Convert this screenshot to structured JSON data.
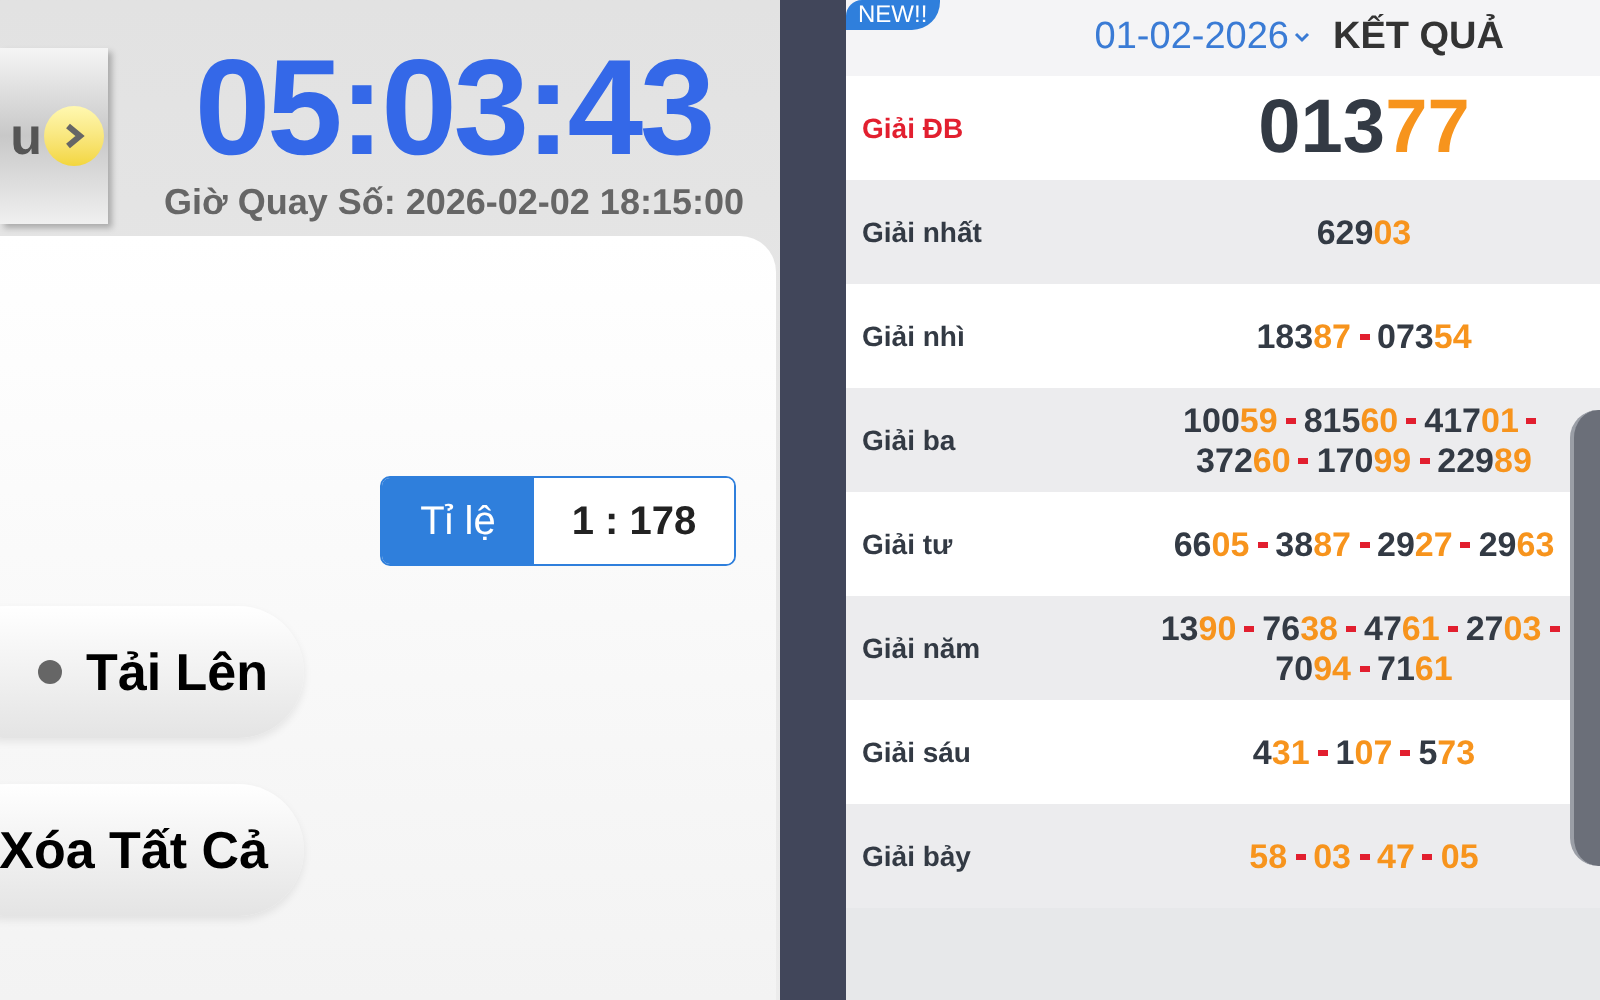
{
  "left": {
    "nav_button": {
      "label": "u"
    },
    "countdown": "05:03:43",
    "draw_time": "Giờ Quay Số: 2026-02-02 18:15:00",
    "ratio": {
      "label": "Tỉ lệ",
      "value": "1 : 178"
    },
    "buttons": [
      {
        "label": "Tải Lên",
        "kind": "dot"
      },
      {
        "label": "Xóa Tất Cả",
        "kind": "plain"
      }
    ]
  },
  "results": {
    "badge": "NEW!!",
    "date": "01-02-2026",
    "title": "KẾT QUẢ",
    "prizes": [
      {
        "label": "Giải ĐB",
        "kind": "special",
        "lines": [
          [
            {
              "head": "013",
              "tail": "77"
            }
          ]
        ]
      },
      {
        "label": "Giải nhất",
        "kind": "normal",
        "lines": [
          [
            {
              "head": "629",
              "tail": "03"
            }
          ]
        ]
      },
      {
        "label": "Giải nhì",
        "kind": "normal",
        "lines": [
          [
            {
              "head": "183",
              "tail": "87"
            },
            {
              "head": "073",
              "tail": "54"
            }
          ]
        ]
      },
      {
        "label": "Giải ba",
        "kind": "normal",
        "lines": [
          [
            {
              "head": "100",
              "tail": "59"
            },
            {
              "head": "815",
              "tail": "60"
            },
            {
              "head": "417",
              "tail": "01"
            }
          ],
          [
            {
              "head": "372",
              "tail": "60"
            },
            {
              "head": "170",
              "tail": "99"
            },
            {
              "head": "229",
              "tail": "89"
            }
          ]
        ]
      },
      {
        "label": "Giải tư",
        "kind": "normal",
        "lines": [
          [
            {
              "head": "66",
              "tail": "05"
            },
            {
              "head": "38",
              "tail": "87"
            },
            {
              "head": "29",
              "tail": "27"
            },
            {
              "head": "29",
              "tail": "63"
            }
          ]
        ]
      },
      {
        "label": "Giải năm",
        "kind": "normal",
        "lines": [
          [
            {
              "head": "13",
              "tail": "90"
            },
            {
              "head": "76",
              "tail": "38"
            },
            {
              "head": "47",
              "tail": "61"
            },
            {
              "head": "27",
              "tail": "03"
            }
          ],
          [
            {
              "head": "70",
              "tail": "94"
            },
            {
              "head": "71",
              "tail": "61"
            }
          ]
        ]
      },
      {
        "label": "Giải sáu",
        "kind": "normal",
        "lines": [
          [
            {
              "head": "4",
              "tail": "31"
            },
            {
              "head": "1",
              "tail": "07"
            },
            {
              "head": "5",
              "tail": "73"
            }
          ]
        ]
      },
      {
        "label": "Giải bảy",
        "kind": "normal",
        "lines": [
          [
            {
              "tail": "58"
            },
            {
              "tail": "03"
            },
            {
              "tail": "47"
            },
            {
              "tail": "05"
            }
          ]
        ]
      }
    ]
  }
}
